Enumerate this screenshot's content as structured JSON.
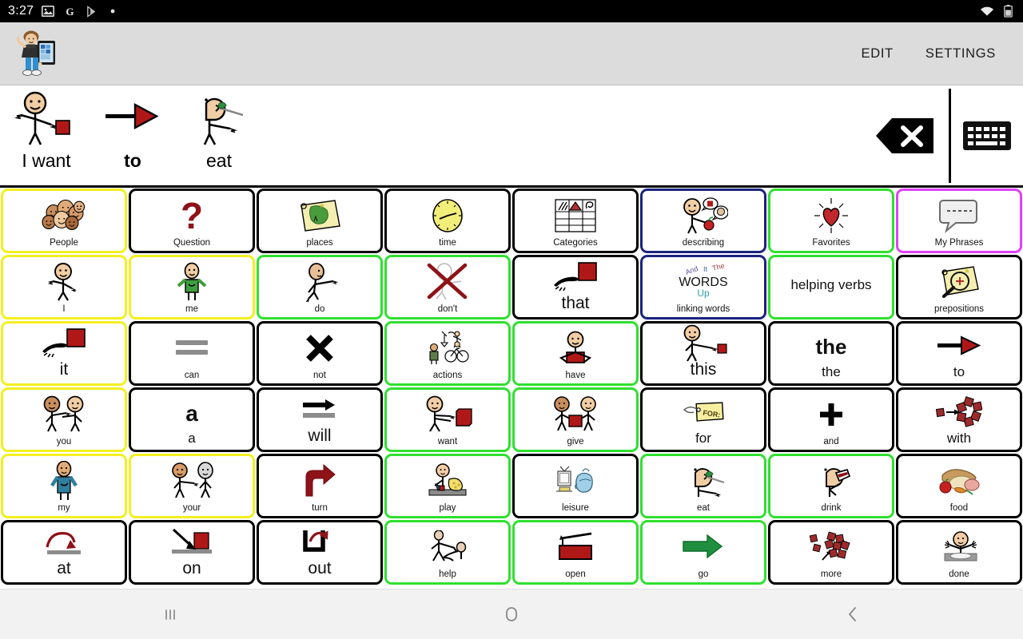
{
  "statusbar": {
    "clock": "3:27",
    "icons": [
      "image-icon",
      "google-icon",
      "play-store-icon",
      "dot-icon"
    ],
    "right_icons": [
      "wifi-icon",
      "battery-icon"
    ]
  },
  "appbar": {
    "logo_name": "boy-with-tablet-logo",
    "edit_label": "EDIT",
    "settings_label": "SETTINGS"
  },
  "sentence_bar": {
    "items": [
      {
        "label": "I want",
        "bold": false,
        "pic": "person-pointing-self-red-square"
      },
      {
        "label": "to",
        "bold": true,
        "pic": "arrow-right-red"
      },
      {
        "label": "eat",
        "bold": false,
        "pic": "person-eating-fork"
      }
    ],
    "delete_button": "backspace-delete-icon",
    "keyboard_button": "keyboard-icon"
  },
  "grid": {
    "columns": 8,
    "cells": [
      {
        "label": "People",
        "pic": "group-of-faces",
        "border": "yellow",
        "size": "small"
      },
      {
        "label": "Question",
        "pic": "question-mark",
        "border": "black",
        "size": "small"
      },
      {
        "label": "places",
        "pic": "map-scroll",
        "border": "black",
        "size": "small"
      },
      {
        "label": "time",
        "pic": "clock-face",
        "border": "black",
        "size": "small"
      },
      {
        "label": "Categories",
        "pic": "grid-table-symbols",
        "border": "black",
        "size": "small"
      },
      {
        "label": "describing",
        "pic": "person-describing-apple",
        "border": "blue",
        "size": "small"
      },
      {
        "label": "Favorites",
        "pic": "shining-heart",
        "border": "green",
        "size": "small"
      },
      {
        "label": "My Phrases",
        "pic": "speech-bubble-dashed",
        "border": "magenta",
        "size": "small"
      },
      {
        "label": "I",
        "pic": "person-pointing-self",
        "border": "yellow",
        "size": "small"
      },
      {
        "label": "me",
        "pic": "person-green-shirt-pointing-self",
        "border": "yellow",
        "size": "small"
      },
      {
        "label": "do",
        "pic": "person-arm-out",
        "border": "green",
        "size": "small"
      },
      {
        "label": "don't",
        "pic": "crossed-out-person",
        "border": "green",
        "size": "small"
      },
      {
        "label": "that",
        "pic": "hand-pointing-red-square",
        "border": "black",
        "size": "big"
      },
      {
        "label": "linking words",
        "pic": "words-up-wordcard",
        "border": "blue",
        "size": "small"
      },
      {
        "label": "helping verbs",
        "pic": "none",
        "border": "green",
        "size": "med"
      },
      {
        "label": "prepositions",
        "pic": "magnifier-map",
        "border": "black",
        "size": "small"
      },
      {
        "label": "it",
        "pic": "hand-pointing-red-square",
        "border": "yellow",
        "size": "big"
      },
      {
        "label": "can",
        "pic": "equals-gray-bars",
        "border": "black",
        "size": "small"
      },
      {
        "label": "not",
        "pic": "black-x",
        "border": "black",
        "size": "small"
      },
      {
        "label": "actions",
        "pic": "person-activities",
        "border": "green",
        "size": "small"
      },
      {
        "label": "have",
        "pic": "person-holding-red-book",
        "border": "green",
        "size": "small"
      },
      {
        "label": "this",
        "pic": "person-pointing-small-red-square",
        "border": "black",
        "size": "big"
      },
      {
        "label": "the",
        "pic": "text-the-bold",
        "border": "black",
        "size": "med"
      },
      {
        "label": "to",
        "pic": "arrow-right-red",
        "border": "black",
        "size": "med"
      },
      {
        "label": "you",
        "pic": "two-people-pointing",
        "border": "yellow",
        "size": "small"
      },
      {
        "label": "a",
        "pic": "text-a-bold",
        "border": "black",
        "size": "med"
      },
      {
        "label": "will",
        "pic": "arrow-right-black-gray-bar",
        "border": "black",
        "size": "big"
      },
      {
        "label": "want",
        "pic": "person-reaching-red-book",
        "border": "green",
        "size": "small"
      },
      {
        "label": "give",
        "pic": "two-people-red-book",
        "border": "green",
        "size": "small"
      },
      {
        "label": "for",
        "pic": "yellow-for-tag",
        "border": "black",
        "size": "med"
      },
      {
        "label": "and",
        "pic": "black-plus",
        "border": "black",
        "size": "small"
      },
      {
        "label": "with",
        "pic": "red-blocks-arrow-joining",
        "border": "black",
        "size": "med"
      },
      {
        "label": "my",
        "pic": "person-blue-shirt-hand-chest",
        "border": "yellow",
        "size": "small"
      },
      {
        "label": "your",
        "pic": "person-pointing-other",
        "border": "yellow",
        "size": "small"
      },
      {
        "label": "turn",
        "pic": "dark-red-turn-arrow",
        "border": "black",
        "size": "small"
      },
      {
        "label": "play",
        "pic": "person-playing-blocks",
        "border": "green",
        "size": "small"
      },
      {
        "label": "leisure",
        "pic": "tv-and-chair",
        "border": "black",
        "size": "small"
      },
      {
        "label": "eat",
        "pic": "person-eating-fork",
        "border": "green",
        "size": "small"
      },
      {
        "label": "drink",
        "pic": "person-drinking-cup",
        "border": "green",
        "size": "small"
      },
      {
        "label": "food",
        "pic": "assorted-food",
        "border": "black",
        "size": "small"
      },
      {
        "label": "at",
        "pic": "arrow-onto-gray-bar",
        "border": "black",
        "size": "big"
      },
      {
        "label": "on",
        "pic": "arrow-onto-red-square",
        "border": "black",
        "size": "big"
      },
      {
        "label": "out",
        "pic": "arrow-out-of-container",
        "border": "black",
        "size": "big"
      },
      {
        "label": "help",
        "pic": "person-helping-person",
        "border": "green",
        "size": "small"
      },
      {
        "label": "open",
        "pic": "opening-red-box",
        "border": "green",
        "size": "small"
      },
      {
        "label": "go",
        "pic": "green-arrow-right",
        "border": "green",
        "size": "small"
      },
      {
        "label": "more",
        "pic": "red-blocks-more",
        "border": "black",
        "size": "small"
      },
      {
        "label": "done",
        "pic": "person-hands-up-empty-plate",
        "border": "black",
        "size": "small"
      }
    ]
  },
  "navbar": {
    "recents_label": "recents-icon",
    "home_label": "home-icon",
    "back_label": "back-icon"
  },
  "colors": {
    "yellow": "#f4ef1f",
    "green": "#2fe02f",
    "black": "#000000",
    "blue": "#1a237e",
    "magenta": "#e040fb",
    "appbar_bg": "#dcdcdc",
    "red": "#b01818"
  }
}
